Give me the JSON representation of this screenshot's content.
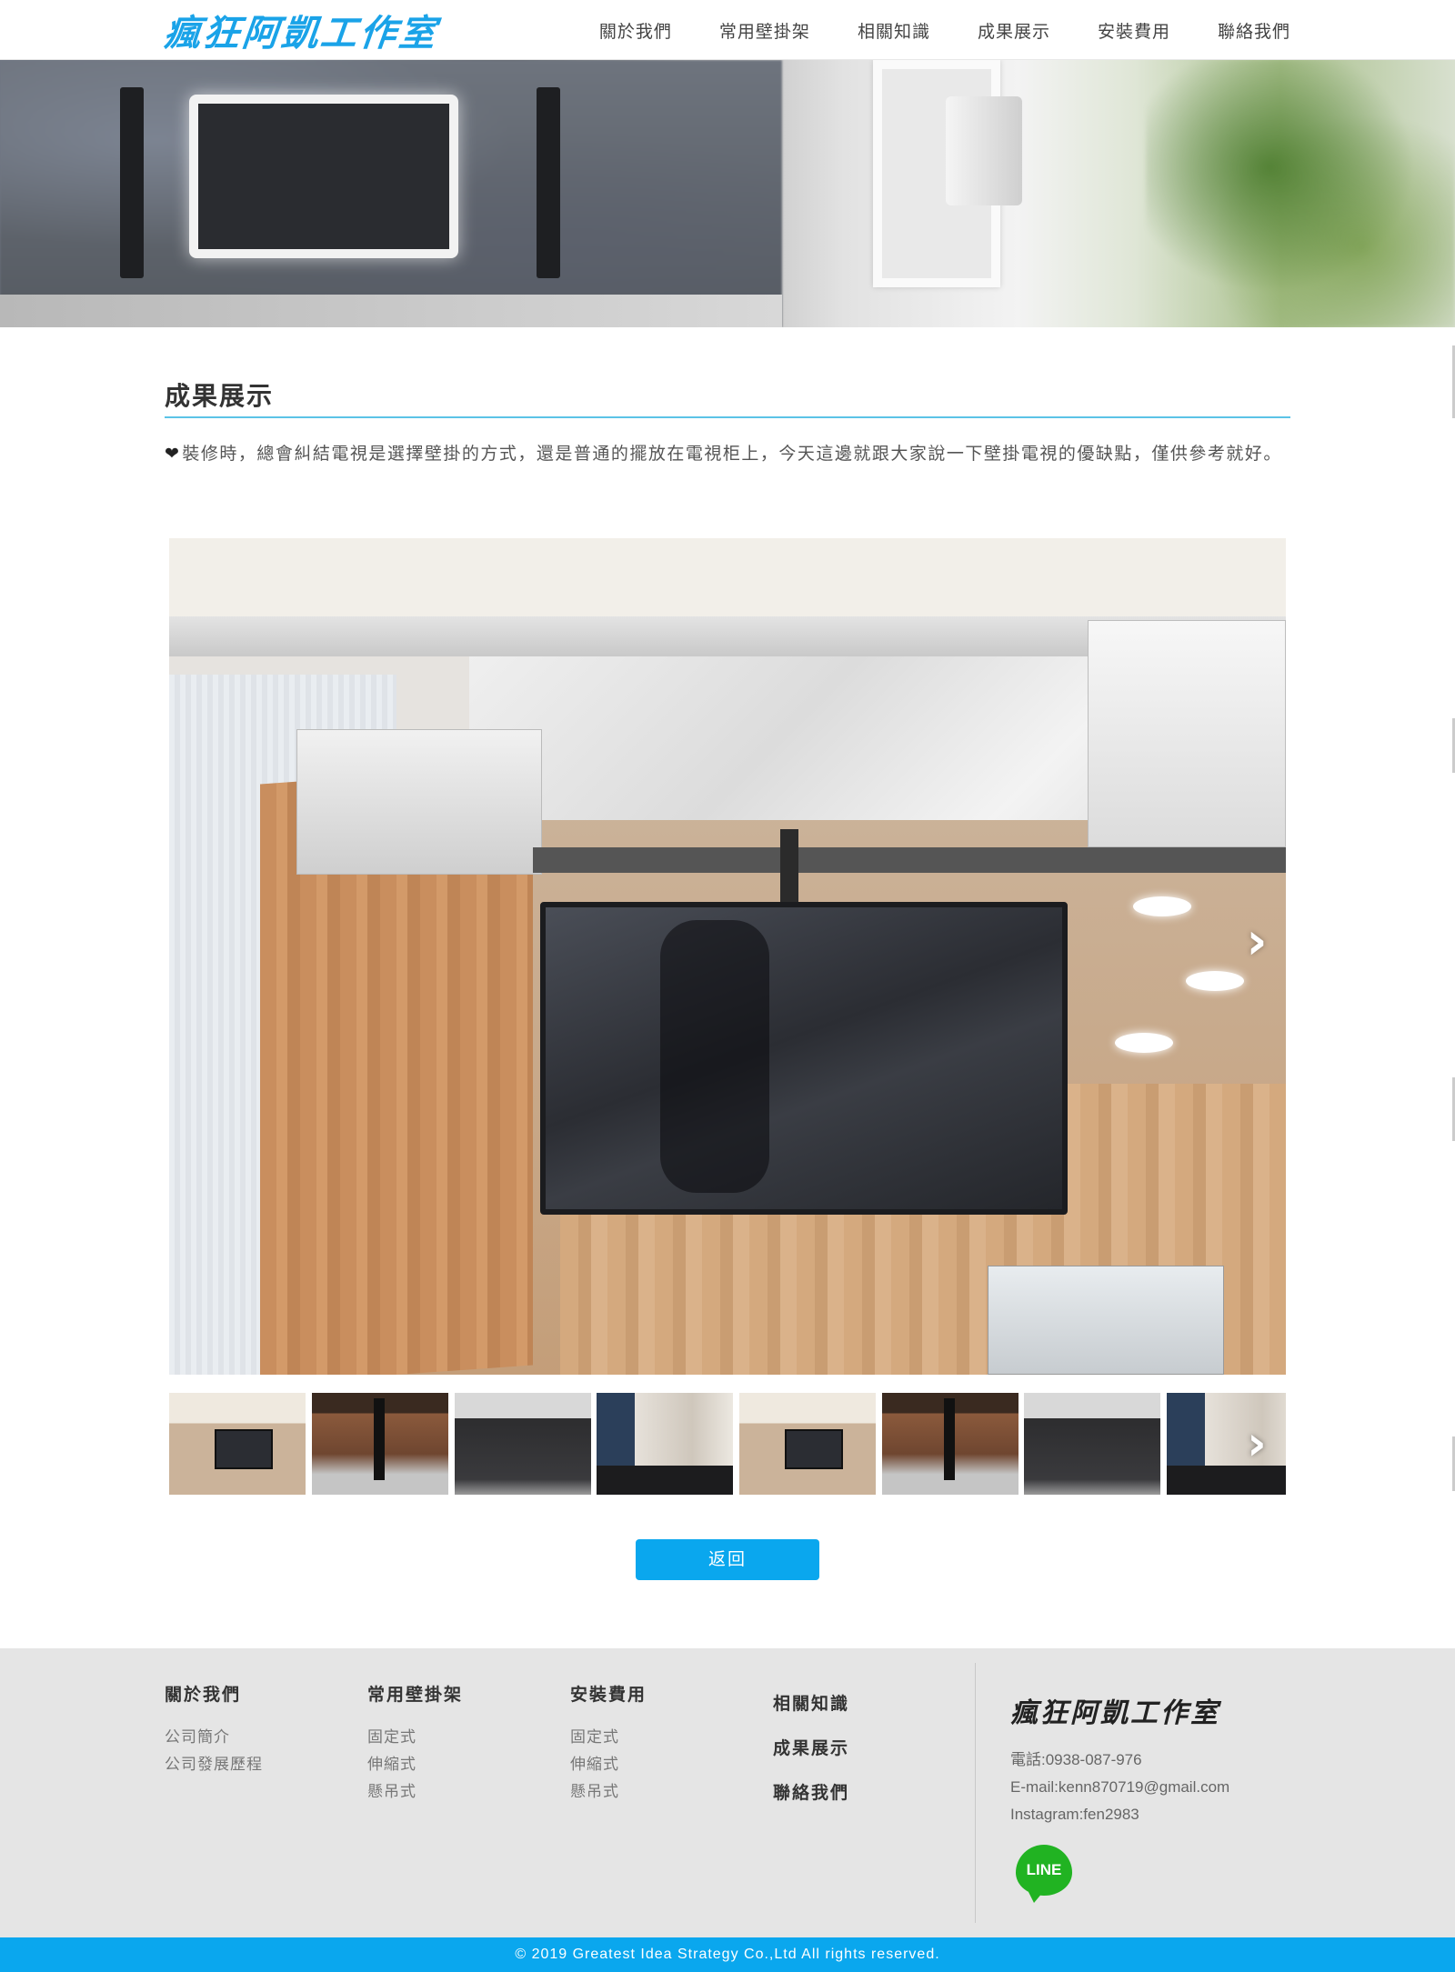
{
  "header": {
    "logo_text": "瘋狂阿凱工作室",
    "nav": [
      "關於我們",
      "常用壁掛架",
      "相關知識",
      "成果展示",
      "安裝費用",
      "聯絡我們"
    ]
  },
  "main": {
    "title": "成果展示",
    "intro": "裝修時，總會糾結電視是選擇壁掛的方式，還是普通的擺放在電視柜上，今天這邊就跟大家說一下壁掛電視的優缺點，僅供參考就好。",
    "heart_icon": "❤",
    "next_icon": "›",
    "back_label": "返回"
  },
  "footer": {
    "col1": {
      "title": "關於我們",
      "links": [
        "公司簡介",
        "公司發展歷程"
      ]
    },
    "col2": {
      "title": "常用壁掛架",
      "links": [
        "固定式",
        "伸縮式",
        "懸吊式"
      ]
    },
    "col3": {
      "title": "安裝費用",
      "links": [
        "固定式",
        "伸縮式",
        "懸吊式"
      ]
    },
    "col4": [
      "相關知識",
      "成果展示",
      "聯絡我們"
    ],
    "contact": {
      "logo_text": "瘋狂阿凱工作室",
      "phone": "電話:0938-087-976",
      "email": "E-mail:kenn870719@gmail.com",
      "instagram": "Instagram:fen2983",
      "line_label": "LINE"
    },
    "copyright": "© 2019 Greatest Idea Strategy Co.,Ltd All rights reserved."
  },
  "colors": {
    "accent": "#0aa7ee",
    "logo": "#1aa3e8",
    "rule": "#5bc3e7",
    "line_green": "#21b322"
  }
}
